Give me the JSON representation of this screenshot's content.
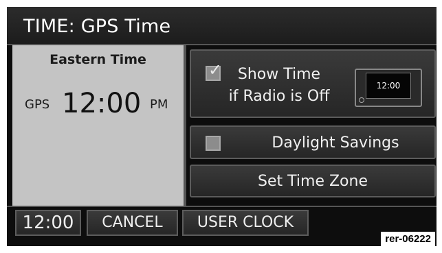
{
  "header": {
    "title": "TIME: GPS Time"
  },
  "clock_panel": {
    "zone": "Eastern Time",
    "source": "GPS",
    "time": "12:00",
    "ampm": "PM"
  },
  "options": {
    "show_time": {
      "label": "Show Time\nif Radio is Off",
      "checked": true,
      "preview_time": "12:00"
    },
    "daylight_savings": {
      "label": "Daylight Savings",
      "checked": false
    },
    "set_time_zone": {
      "label": "Set Time Zone"
    }
  },
  "bottom_bar": {
    "clock": "12:00",
    "cancel": "CANCEL",
    "user_clock": "USER CLOCK"
  },
  "reference": "rer-06222",
  "colors": {
    "background": "#0d0d0d",
    "panel": "#c4c4c4",
    "button": "#2e2e2e",
    "text": "#f0f0f0"
  }
}
